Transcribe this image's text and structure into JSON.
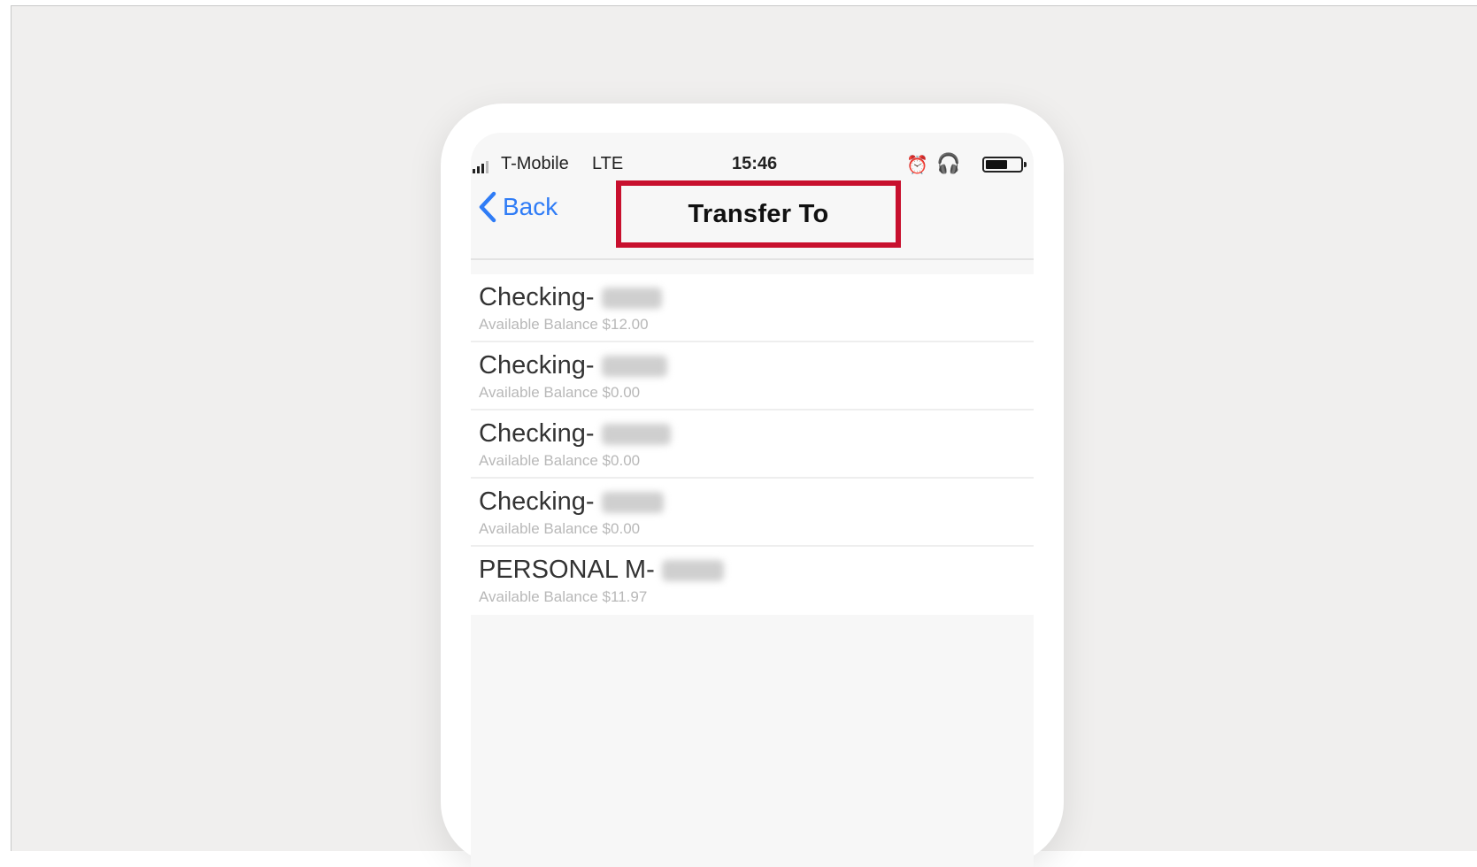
{
  "status_bar": {
    "carrier": "T-Mobile",
    "network": "LTE",
    "time": "15:46",
    "icons": [
      "signal-icon",
      "alarm-icon",
      "headphones-icon",
      "battery-icon"
    ]
  },
  "nav": {
    "back_label": "Back",
    "title": "Transfer To",
    "highlight_color": "#c8102e",
    "accent_color": "#2f7cf6"
  },
  "accounts": [
    {
      "name": "Checking-",
      "balance": "Available Balance $12.00"
    },
    {
      "name": "Checking-",
      "balance": "Available Balance $0.00"
    },
    {
      "name": "Checking-",
      "balance": "Available Balance $0.00"
    },
    {
      "name": "Checking-",
      "balance": "Available Balance $0.00"
    },
    {
      "name": "PERSONAL M-",
      "balance": "Available Balance $11.97"
    }
  ]
}
